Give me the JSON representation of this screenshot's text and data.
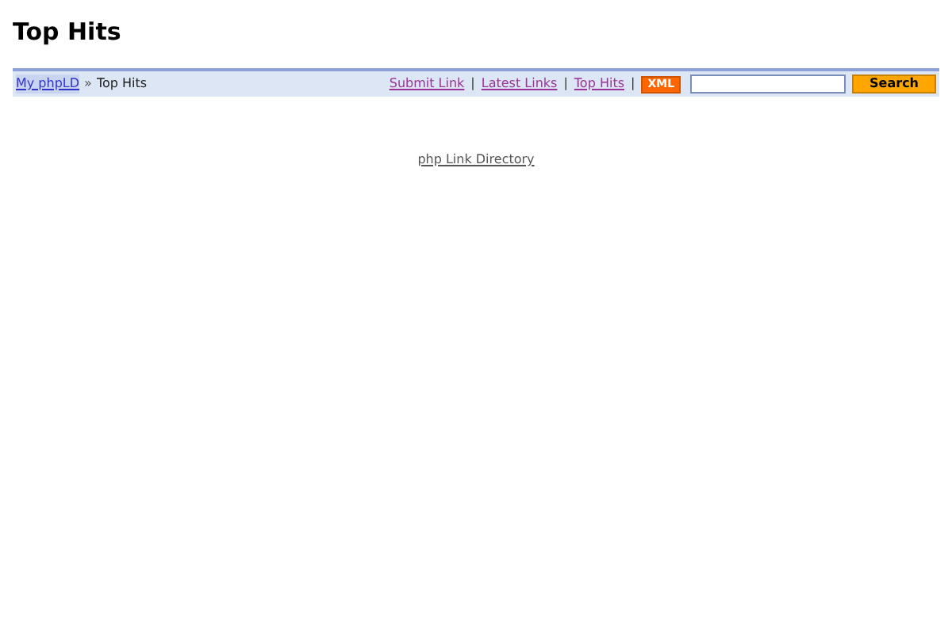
{
  "title": "Top Hits",
  "breadcrumb": {
    "link": "My phpLD",
    "separator": "»",
    "current": "Top Hits"
  },
  "nav_links": [
    {
      "label": "Submit Link"
    },
    {
      "label": "Latest Links"
    },
    {
      "label": "Top Hits"
    }
  ],
  "nav_separator": "|",
  "xml_badge": "XML",
  "search": {
    "button": "Search"
  },
  "footer_link": "php Link Directory"
}
